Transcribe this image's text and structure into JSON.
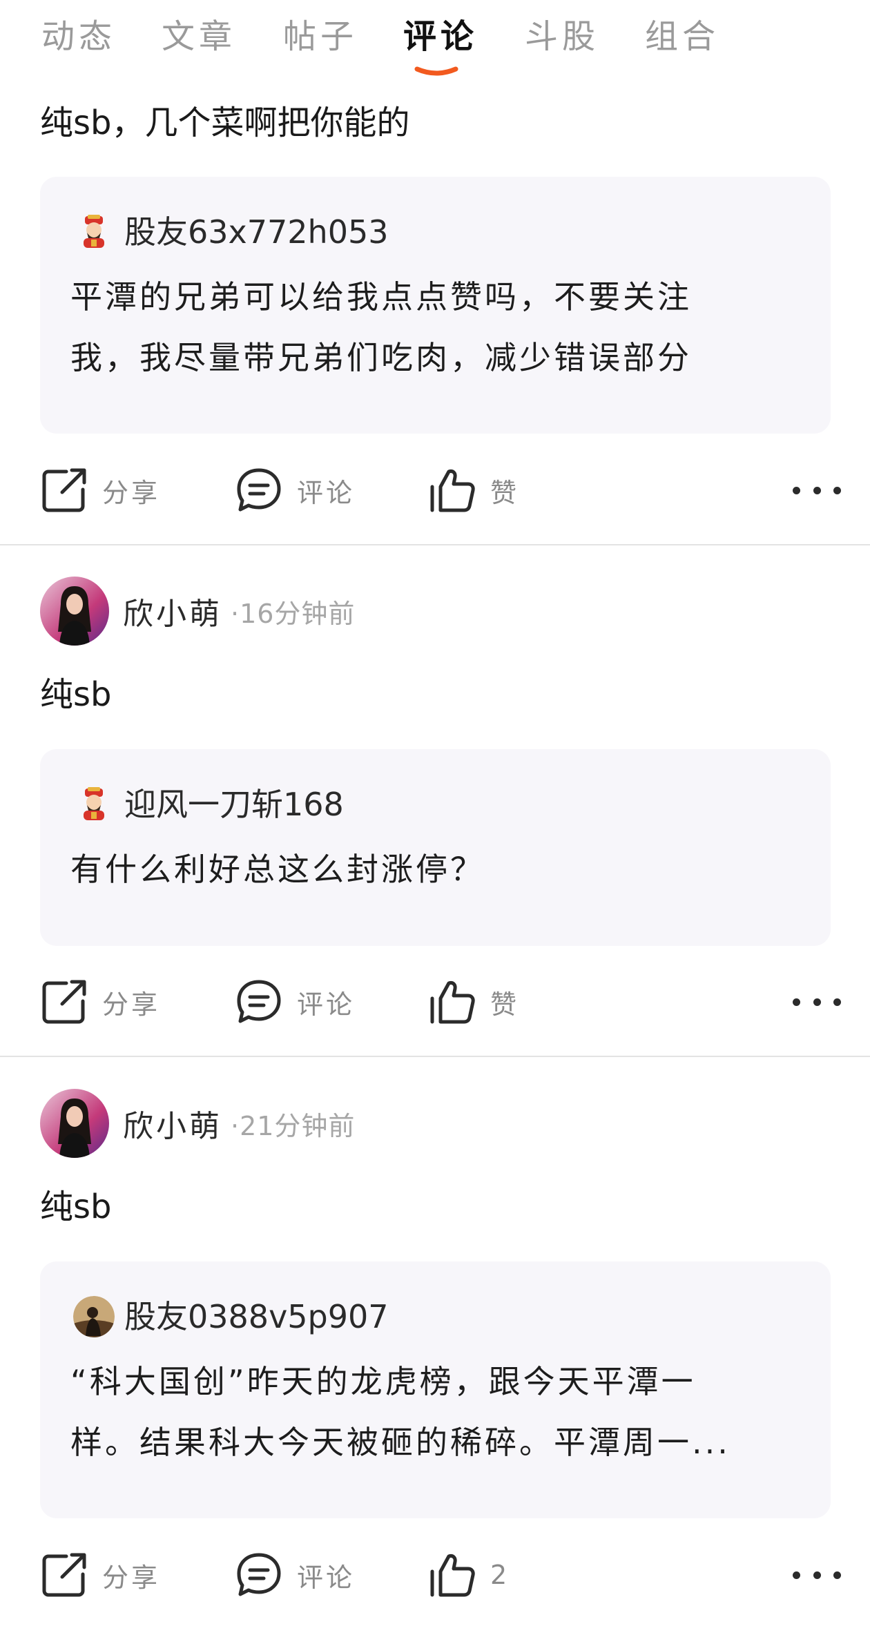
{
  "tabs": [
    {
      "label": "动态",
      "active": false
    },
    {
      "label": "文章",
      "active": false
    },
    {
      "label": "帖子",
      "active": false
    },
    {
      "label": "评论",
      "active": true
    },
    {
      "label": "斗股",
      "active": false
    },
    {
      "label": "组合",
      "active": false
    }
  ],
  "colors": {
    "accent": "#f25a1f",
    "quote_bg": "#f7f6fa",
    "muted_text": "#8a8a8a",
    "divider": "#e3e3e3"
  },
  "posts": [
    {
      "text": "纯sb，几个菜啊把你能的",
      "quote": {
        "avatar_icon": "fortune-god-avatar-icon",
        "author": "股友63x772h053",
        "lines": [
          "平潭的兄弟可以给我点点赞吗，不要关注",
          "我，我尽量带兄弟们吃肉，减少错误部分"
        ]
      },
      "actions": {
        "share": "分享",
        "comment": "评论",
        "like": "赞"
      }
    },
    {
      "author": "欣小萌",
      "time": "·16分钟前",
      "text": "纯sb",
      "quote": {
        "avatar_icon": "fortune-god-avatar-icon",
        "author": "迎风一刀斩168",
        "lines": [
          "有什么利好总这么封涨停？"
        ]
      },
      "actions": {
        "share": "分享",
        "comment": "评论",
        "like": "赞"
      }
    },
    {
      "author": "欣小萌",
      "time": "·21分钟前",
      "text": "纯sb",
      "quote": {
        "avatar_icon": "person-photo-avatar-icon",
        "author": "股友0388v5p907",
        "lines": [
          "“科大国创”昨天的龙虎榜，跟今天平潭一",
          "样。结果科大今天被砸的稀碎。平潭周一..."
        ]
      },
      "actions": {
        "share": "分享",
        "comment": "评论",
        "like": "2"
      }
    }
  ]
}
